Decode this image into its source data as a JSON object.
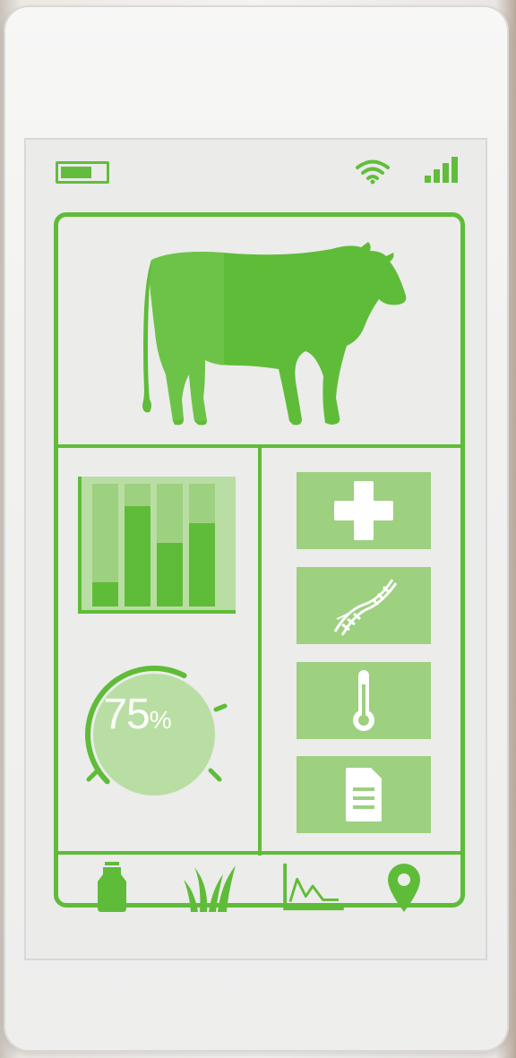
{
  "device": {
    "status_bar": {
      "battery_icon": "battery-icon",
      "battery_level": 0.7,
      "wifi_icon": "wifi-icon",
      "signal_icon": "signal-bars-icon",
      "signal_level": 4
    }
  },
  "hero": {
    "icon": "cow-icon"
  },
  "stats": {
    "bar_chart_icon": "bar-chart-icon",
    "bars": [
      0.2,
      0.82,
      0.52,
      0.68
    ],
    "gauge": {
      "value": "75",
      "unit": "%",
      "fraction": 0.75
    }
  },
  "tiles": [
    {
      "icon": "medical-cross-icon"
    },
    {
      "icon": "dna-icon"
    },
    {
      "icon": "thermometer-icon"
    },
    {
      "icon": "document-icon"
    }
  ],
  "bottom_nav": [
    {
      "icon": "milk-can-icon"
    },
    {
      "icon": "grass-icon"
    },
    {
      "icon": "line-chart-icon"
    },
    {
      "icon": "location-pin-icon"
    }
  ],
  "colors": {
    "accent": "#5fbc38",
    "tile": "#9dd07f",
    "light": "#b9dea3",
    "screen": "#ebebea"
  }
}
